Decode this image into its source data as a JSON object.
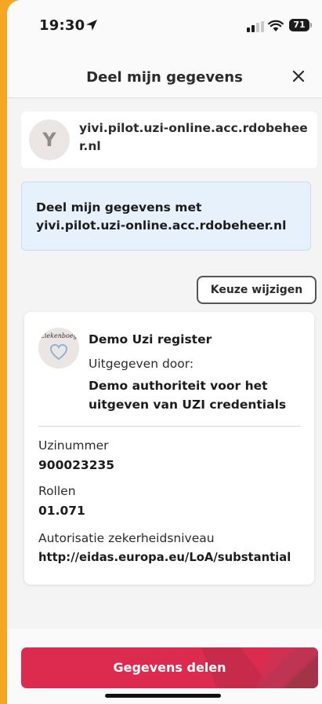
{
  "status_bar": {
    "time": "19:30",
    "battery": "71"
  },
  "header": {
    "title": "Deel mijn gegevens"
  },
  "requestor": {
    "initial": "Y",
    "name": "yivi.pilot.uzi-online.acc.rdobeheer.nl"
  },
  "info": {
    "text": "Deel mijn gegevens met yivi.pilot.uzi-online.acc.rdobeheer.nl"
  },
  "change_choice": {
    "label": "Keuze wijzigen"
  },
  "credential": {
    "logo_text": "Ziekenboeg",
    "title": "Demo Uzi register",
    "issued_by_label": "Uitgegeven door:",
    "issuer": "Demo authoriteit voor het uitgeven van UZI credentials",
    "attributes": [
      {
        "label": "Uzinummer",
        "value": "900023235"
      },
      {
        "label": "Rollen",
        "value": "01.071"
      },
      {
        "label": "Autorisatie zekerheidsniveau",
        "value": "http://eidas.europa.eu/LoA/substantial"
      }
    ]
  },
  "footer": {
    "share_label": "Gegevens delen"
  },
  "colors": {
    "primary": "#dc2b4f",
    "info_bg": "#e6f1fb"
  }
}
